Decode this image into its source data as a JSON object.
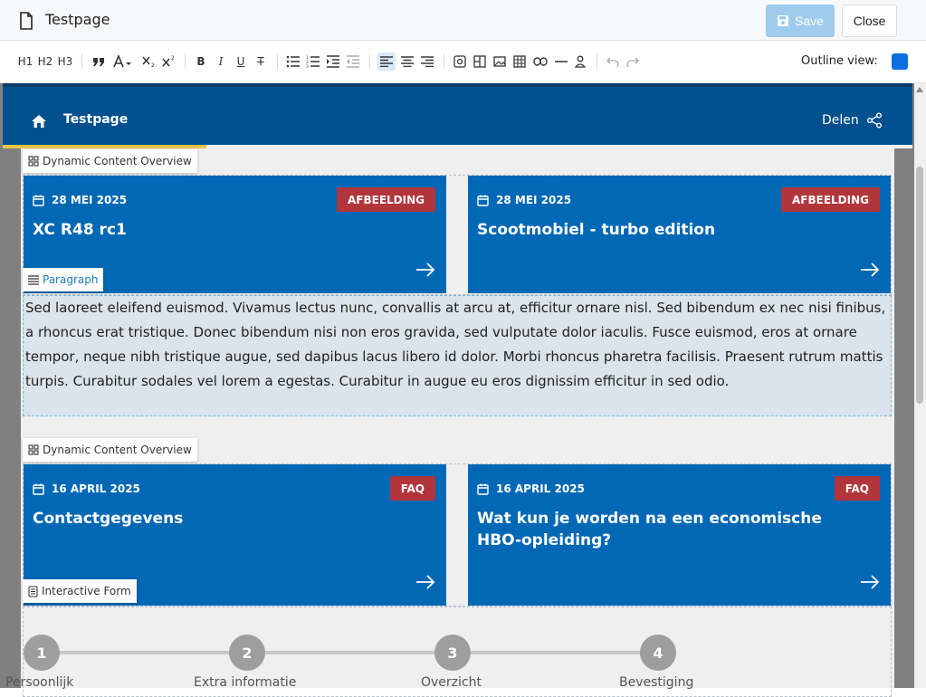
{
  "header": {
    "title": "Testpage",
    "save_label": "Save",
    "close_label": "Close"
  },
  "toolbar": {
    "h1": "H1",
    "h2": "H2",
    "h3": "H3",
    "outline_label": "Outline view:",
    "outline_color": "#0b6fe0"
  },
  "site": {
    "title": "Testpage",
    "share_label": "Delen"
  },
  "blocks": {
    "dco_label": "Dynamic Content Overview",
    "paragraph_label": "Paragraph",
    "form_label": "Interactive Form"
  },
  "cards_row1": [
    {
      "date": "28 MEI 2025",
      "badge": "AFBEELDING",
      "title": "XC R48 rc1"
    },
    {
      "date": "28 MEI 2025",
      "badge": "AFBEELDING",
      "title": "Scootmobiel - turbo edition"
    }
  ],
  "paragraph_text": "Sed laoreet eleifend euismod. Vivamus lectus nunc, convallis at arcu at, efficitur ornare nisl. Sed bibendum ex nec nisi finibus, a rhoncus erat tristique. Donec bibendum nisi non eros gravida, sed vulputate dolor iaculis. Fusce euismod, eros at ornare tempor, neque nibh tristique augue, sed dapibus lacus libero id dolor. Morbi rhoncus pharetra facilisis. Praesent rutrum mattis turpis. Curabitur sodales vel lorem a egestas. Curabitur in augue eu eros dignissim efficitur in sed odio.",
  "cards_row2": [
    {
      "date": "16 APRIL 2025",
      "badge": "FAQ",
      "title": "Contactgegevens"
    },
    {
      "date": "16 APRIL 2025",
      "badge": "FAQ",
      "title": "Wat kun je worden na een economische HBO-opleiding?"
    }
  ],
  "steps": [
    {
      "number": "1",
      "label": "Persoonlijk"
    },
    {
      "number": "2",
      "label": "Extra informatie"
    },
    {
      "number": "3",
      "label": "Overzicht"
    },
    {
      "number": "4",
      "label": "Bevestiging"
    }
  ],
  "colors": {
    "card_blue": "#0068b4",
    "badge_red": "#b1353a",
    "header_blue": "#00508e"
  }
}
